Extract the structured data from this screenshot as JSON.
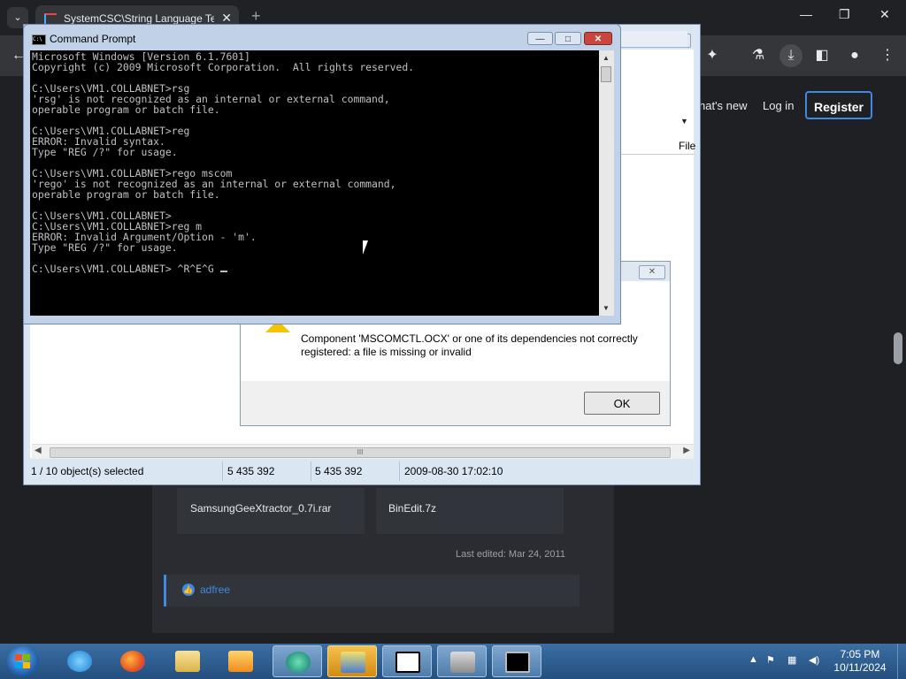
{
  "browser": {
    "tab_title": "SystemCSC\\String Language Te",
    "tab_close": "✕",
    "new_tab": "+",
    "nav": {
      "whats_new": "hat's new",
      "log_in": "Log in",
      "register": "Register"
    }
  },
  "page": {
    "attachments": [
      "SamsungGeeXtractor_0.7i.rar",
      "BinEdit.7z"
    ],
    "last_edited": "Last edited: Mar 24, 2011",
    "reaction_user": "adfree"
  },
  "file_manager": {
    "column_header": "File",
    "scroll_thumb_grip": "III",
    "status": {
      "selection": "1 / 10 object(s) selected",
      "size": "5 435 392",
      "packed_size": "5 435 392",
      "modified": "2009-08-30 17:02:10"
    }
  },
  "error_dialog": {
    "message": "Component 'MSCOMCTL.OCX' or one of its dependencies not correctly registered: a file is missing or invalid",
    "ok_label": "OK"
  },
  "cmd": {
    "title": "Command Prompt",
    "icon_label": "C:\\",
    "lines": [
      "Microsoft Windows [Version 6.1.7601]",
      "Copyright (c) 2009 Microsoft Corporation.  All rights reserved.",
      "",
      "C:\\Users\\VM1.COLLABNET>rsg",
      "'rsg' is not recognized as an internal or external command,",
      "operable program or batch file.",
      "",
      "C:\\Users\\VM1.COLLABNET>reg",
      "ERROR: Invalid syntax.",
      "Type \"REG /?\" for usage.",
      "",
      "C:\\Users\\VM1.COLLABNET>rego mscom",
      "'rego' is not recognized as an internal or external command,",
      "operable program or batch file.",
      "",
      "C:\\Users\\VM1.COLLABNET>",
      "C:\\Users\\VM1.COLLABNET>reg m",
      "ERROR: Invalid Argument/Option - 'm'.",
      "Type \"REG /?\" for usage.",
      ""
    ],
    "prompt_line": "C:\\Users\\VM1.COLLABNET> ^R^E^G "
  },
  "taskbar": {
    "pinned_icons": [
      "start-orb",
      "internet-explorer-icon",
      "firefox-icon",
      "file-explorer-icon",
      "media-player-icon",
      "green-app-icon",
      "windows-update-icon",
      "7zip-icon",
      "tools-icon",
      "command-prompt-icon"
    ],
    "time": "7:05 PM",
    "date": "10/11/2024"
  },
  "colors": {
    "accent": "#3f8ae0",
    "cmd_text": "#c0c0c0",
    "taskbar": "#2c5d91"
  }
}
